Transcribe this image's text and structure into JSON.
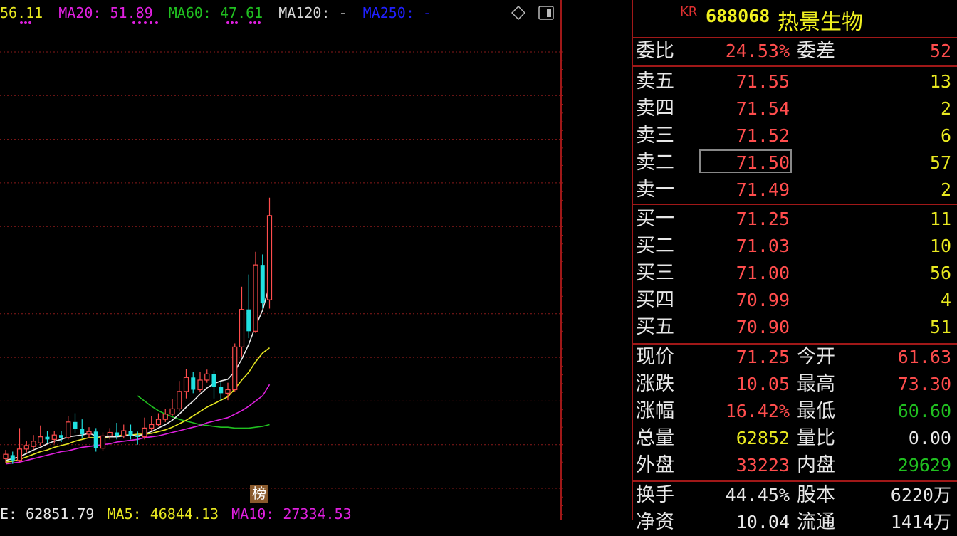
{
  "colors": {
    "up": "#ff4d4d",
    "down": "#20e0e0",
    "white": "#e8e8e8",
    "yellow": "#e8e820",
    "magenta": "#e020e0",
    "green": "#20c020",
    "blue": "#2020ff",
    "grid": "#a01818"
  },
  "ma_bar": {
    "ma5": "56.11",
    "ma20": "MA20: 51.89",
    "ma60": "MA60: 47.61",
    "ma120": "MA120: -",
    "ma250": "MA250: -"
  },
  "price_axis": [
    "90.00",
    "85.00",
    "80.00",
    "75.00",
    "70.00",
    "65.00",
    "60.00",
    "55.00",
    "50.00",
    "45.00",
    "40.00"
  ],
  "badge": "榜",
  "volume_bar": {
    "vol": "E: 62851.79",
    "ma5": "MA5: 46844.13",
    "ma10": "MA10: 27334.53"
  },
  "stock": {
    "market_badge": "KR",
    "code": "688068",
    "name": "热景生物"
  },
  "order_ratio": {
    "label": "委比",
    "value": "24.53%",
    "label2": "委差",
    "value2": "52"
  },
  "sell": [
    {
      "label": "卖五",
      "price": "71.55",
      "qty": "13"
    },
    {
      "label": "卖四",
      "price": "71.54",
      "qty": "2"
    },
    {
      "label": "卖三",
      "price": "71.52",
      "qty": "6"
    },
    {
      "label": "卖二",
      "price": "71.50",
      "qty": "57"
    },
    {
      "label": "卖一",
      "price": "71.49",
      "qty": "2"
    }
  ],
  "buy": [
    {
      "label": "买一",
      "price": "71.25",
      "qty": "11"
    },
    {
      "label": "买二",
      "price": "71.03",
      "qty": "10"
    },
    {
      "label": "买三",
      "price": "71.00",
      "qty": "56"
    },
    {
      "label": "买四",
      "price": "70.99",
      "qty": "4"
    },
    {
      "label": "买五",
      "price": "70.90",
      "qty": "51"
    }
  ],
  "stats": [
    {
      "label": "现价",
      "value": "71.25",
      "label2": "今开",
      "value2": "61.63"
    },
    {
      "label": "涨跌",
      "value": "10.05",
      "label2": "最高",
      "value2": "73.30"
    },
    {
      "label": "涨幅",
      "value": "16.42%",
      "label2": "最低",
      "value2": "60.60"
    },
    {
      "label": "总量",
      "value": "62852",
      "label2": "量比",
      "value2": "0.00"
    },
    {
      "label": "外盘",
      "value": "33223",
      "label2": "内盘",
      "value2": "29629"
    }
  ],
  "stats2": [
    {
      "label": "换手",
      "value": "44.45%",
      "label2": "股本",
      "value2": "6220万"
    },
    {
      "label": "净资",
      "value": "10.04",
      "label2": "流通",
      "value2": "1414万"
    }
  ],
  "candles": [
    {
      "o": 43.4,
      "c": 43.9,
      "h": 44.4,
      "l": 42.9
    },
    {
      "o": 43.8,
      "c": 43.2,
      "h": 44.2,
      "l": 42.8
    },
    {
      "o": 43.2,
      "c": 44.5,
      "h": 46.9,
      "l": 43.0
    },
    {
      "o": 44.5,
      "c": 44.9,
      "h": 45.4,
      "l": 44.1
    },
    {
      "o": 44.8,
      "c": 45.4,
      "h": 46.1,
      "l": 44.4
    },
    {
      "o": 45.2,
      "c": 45.9,
      "h": 47.2,
      "l": 44.9
    },
    {
      "o": 45.9,
      "c": 45.6,
      "h": 46.6,
      "l": 45.2
    },
    {
      "o": 45.6,
      "c": 46.1,
      "h": 46.6,
      "l": 45.1
    },
    {
      "o": 46.1,
      "c": 45.8,
      "h": 46.6,
      "l": 45.3
    },
    {
      "o": 45.8,
      "c": 47.6,
      "h": 48.3,
      "l": 45.6
    },
    {
      "o": 47.6,
      "c": 46.8,
      "h": 48.6,
      "l": 46.3
    },
    {
      "o": 46.8,
      "c": 46.2,
      "h": 47.9,
      "l": 45.8
    },
    {
      "o": 46.2,
      "c": 46.5,
      "h": 47.0,
      "l": 45.8
    },
    {
      "o": 46.5,
      "c": 44.6,
      "h": 46.9,
      "l": 44.2
    },
    {
      "o": 44.6,
      "c": 46.0,
      "h": 46.4,
      "l": 44.3
    },
    {
      "o": 46.0,
      "c": 46.4,
      "h": 46.9,
      "l": 45.6
    },
    {
      "o": 46.4,
      "c": 46.0,
      "h": 47.5,
      "l": 45.6
    },
    {
      "o": 46.0,
      "c": 46.6,
      "h": 47.3,
      "l": 45.7
    },
    {
      "o": 46.6,
      "c": 46.0,
      "h": 47.3,
      "l": 45.6
    },
    {
      "o": 46.0,
      "c": 45.9,
      "h": 46.5,
      "l": 45.0
    },
    {
      "o": 45.9,
      "c": 46.9,
      "h": 48.1,
      "l": 45.6
    },
    {
      "o": 46.9,
      "c": 47.3,
      "h": 48.3,
      "l": 46.6
    },
    {
      "o": 47.3,
      "c": 47.9,
      "h": 48.6,
      "l": 47.1
    },
    {
      "o": 47.9,
      "c": 48.5,
      "h": 49.1,
      "l": 47.6
    },
    {
      "o": 48.5,
      "c": 49.1,
      "h": 50.2,
      "l": 48.3
    },
    {
      "o": 49.1,
      "c": 51.1,
      "h": 52.3,
      "l": 48.8
    },
    {
      "o": 51.1,
      "c": 52.7,
      "h": 53.7,
      "l": 50.3
    },
    {
      "o": 52.7,
      "c": 51.3,
      "h": 53.3,
      "l": 50.9
    },
    {
      "o": 51.3,
      "c": 52.4,
      "h": 53.3,
      "l": 51.0
    },
    {
      "o": 52.4,
      "c": 53.1,
      "h": 53.6,
      "l": 52.1
    },
    {
      "o": 53.1,
      "c": 51.6,
      "h": 53.5,
      "l": 50.3
    },
    {
      "o": 51.6,
      "c": 50.9,
      "h": 52.2,
      "l": 50.0
    },
    {
      "o": 50.9,
      "c": 51.3,
      "h": 52.1,
      "l": 50.1
    },
    {
      "o": 51.3,
      "c": 56.2,
      "h": 56.6,
      "l": 51.1
    },
    {
      "o": 56.2,
      "c": 60.5,
      "h": 63.1,
      "l": 55.1
    },
    {
      "o": 60.5,
      "c": 58.0,
      "h": 64.5,
      "l": 57.2
    },
    {
      "o": 58.0,
      "c": 65.6,
      "h": 67.1,
      "l": 57.8
    },
    {
      "o": 65.6,
      "c": 61.2,
      "h": 66.8,
      "l": 60.6
    },
    {
      "o": 61.6,
      "c": 71.25,
      "h": 73.3,
      "l": 60.6
    }
  ],
  "ma_lines": {
    "ma5": [
      43.2,
      43.4,
      43.6,
      44.0,
      44.4,
      44.7,
      45.1,
      45.4,
      45.6,
      45.9,
      46.0,
      46.1,
      46.3,
      46.0,
      45.9,
      45.9,
      45.9,
      46.0,
      46.1,
      46.0,
      46.2,
      46.5,
      46.9,
      47.3,
      47.8,
      48.5,
      49.3,
      50.0,
      50.8,
      51.5,
      52.0,
      52.3,
      52.5,
      53.4,
      54.8,
      56.5,
      58.6,
      60.4,
      63.3
    ],
    "ma10": [
      43.0,
      43.1,
      43.3,
      43.6,
      43.9,
      44.2,
      44.4,
      44.7,
      44.9,
      45.1,
      45.4,
      45.6,
      45.8,
      45.8,
      45.8,
      45.9,
      46.0,
      46.1,
      46.1,
      46.2,
      46.2,
      46.3,
      46.5,
      46.7,
      47.0,
      47.4,
      47.8,
      48.3,
      48.8,
      49.3,
      49.7,
      50.1,
      50.5,
      51.4,
      52.4,
      53.3,
      54.5,
      55.5,
      56.1
    ],
    "ma20": [
      42.8,
      42.9,
      43.0,
      43.2,
      43.4,
      43.6,
      43.8,
      44.0,
      44.2,
      44.3,
      44.5,
      44.7,
      44.8,
      44.9,
      45.0,
      45.1,
      45.3,
      45.4,
      45.5,
      45.6,
      45.8,
      45.9,
      46.0,
      46.2,
      46.4,
      46.6,
      46.8,
      47.0,
      47.2,
      47.5,
      47.7,
      47.9,
      48.1,
      48.5,
      48.9,
      49.4,
      50.0,
      50.6,
      51.89
    ],
    "ma60_start": 19,
    "ma60": [
      50.6,
      50.0,
      49.4,
      48.9,
      48.5,
      48.2,
      47.9,
      47.7,
      47.5,
      47.3,
      47.2,
      47.1,
      47.0,
      47.0,
      46.9,
      46.9,
      46.9,
      47.0,
      47.1,
      47.3
    ]
  }
}
